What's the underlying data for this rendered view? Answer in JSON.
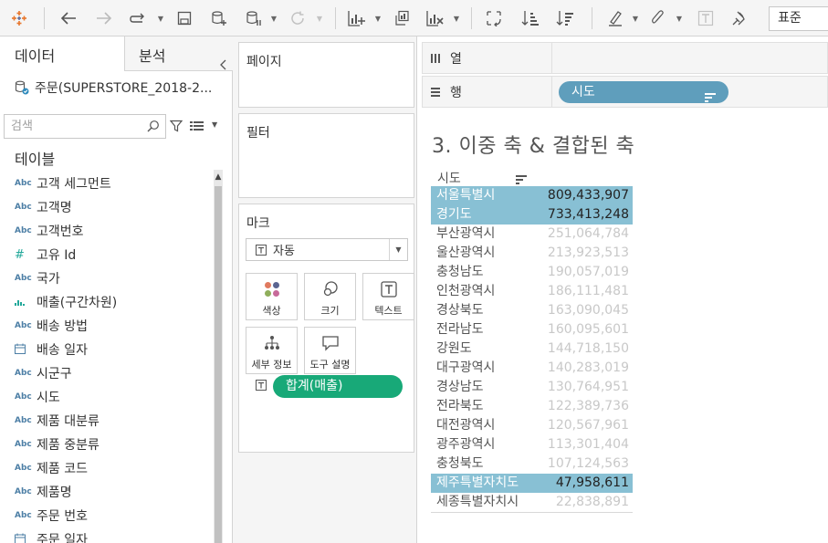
{
  "toolbar": {
    "zoom_select": "표준",
    "icons": [
      "tableau-logo-icon",
      "back-icon",
      "forward-icon",
      "connect-icon",
      "save-icon",
      "new-datasource-icon",
      "pause-update-icon",
      "refresh-icon",
      "new-worksheet-icon",
      "duplicate-icon",
      "clear-icon",
      "swap-icon",
      "sort-ascending-icon",
      "sort-descending-icon",
      "highlight-icon",
      "annotate-icon",
      "labels-icon",
      "fix-axes-icon"
    ]
  },
  "data_pane": {
    "tab_data": "데이터",
    "tab_analysis": "분석",
    "datasource": "주문(SUPERSTORE_2018-2...",
    "search_placeholder": "검색",
    "tables_title": "테이블",
    "fields": [
      {
        "type": "Abc",
        "name": "고객 세그먼트"
      },
      {
        "type": "Abc",
        "name": "고객명"
      },
      {
        "type": "Abc",
        "name": "고객번호"
      },
      {
        "type": "#",
        "name": "고유 Id"
      },
      {
        "type": "Abc",
        "name": "국가"
      },
      {
        "type": "bin",
        "name": "매출(구간차원)"
      },
      {
        "type": "Abc",
        "name": "배송 방법"
      },
      {
        "type": "date",
        "name": "배송 일자"
      },
      {
        "type": "Abc",
        "name": "시군구"
      },
      {
        "type": "Abc",
        "name": "시도"
      },
      {
        "type": "Abc",
        "name": "제품 대분류"
      },
      {
        "type": "Abc",
        "name": "제품 중분류"
      },
      {
        "type": "Abc",
        "name": "제품 코드"
      },
      {
        "type": "Abc",
        "name": "제품명"
      },
      {
        "type": "Abc",
        "name": "주문 번호"
      },
      {
        "type": "date",
        "name": "주문 일자"
      }
    ]
  },
  "shelves": {
    "pages": "페이지",
    "filters": "필터",
    "marks": "마크",
    "mark_type": "자동",
    "mark_buttons": {
      "color": "색상",
      "size": "크기",
      "text": "텍스트",
      "detail": "세부 정보",
      "tooltip": "도구 설명"
    },
    "text_pill": "합계(매출)"
  },
  "columns_shelf": "열",
  "rows_shelf": "행",
  "rows_pill": "시도",
  "viz": {
    "title": "3. 이중 축 & 결합된 축",
    "header": "시도",
    "rows": [
      {
        "name": "서울특별시",
        "value": "809,433,907",
        "hl": true
      },
      {
        "name": "경기도",
        "value": "733,413,248",
        "hl": true
      },
      {
        "name": "부산광역시",
        "value": "251,064,784",
        "hl": false
      },
      {
        "name": "울산광역시",
        "value": "213,923,513",
        "hl": false
      },
      {
        "name": "충청남도",
        "value": "190,057,019",
        "hl": false
      },
      {
        "name": "인천광역시",
        "value": "186,111,481",
        "hl": false
      },
      {
        "name": "경상북도",
        "value": "163,090,045",
        "hl": false
      },
      {
        "name": "전라남도",
        "value": "160,095,601",
        "hl": false
      },
      {
        "name": "강원도",
        "value": "144,718,150",
        "hl": false
      },
      {
        "name": "대구광역시",
        "value": "140,283,019",
        "hl": false
      },
      {
        "name": "경상남도",
        "value": "130,764,951",
        "hl": false
      },
      {
        "name": "전라북도",
        "value": "122,389,736",
        "hl": false
      },
      {
        "name": "대전광역시",
        "value": "120,567,961",
        "hl": false
      },
      {
        "name": "광주광역시",
        "value": "113,301,404",
        "hl": false
      },
      {
        "name": "충청북도",
        "value": "107,124,563",
        "hl": false
      },
      {
        "name": "제주특별자치도",
        "value": "47,958,611",
        "hl": true
      },
      {
        "name": "세종특별자치시",
        "value": "22,838,891",
        "hl": false
      }
    ]
  }
}
